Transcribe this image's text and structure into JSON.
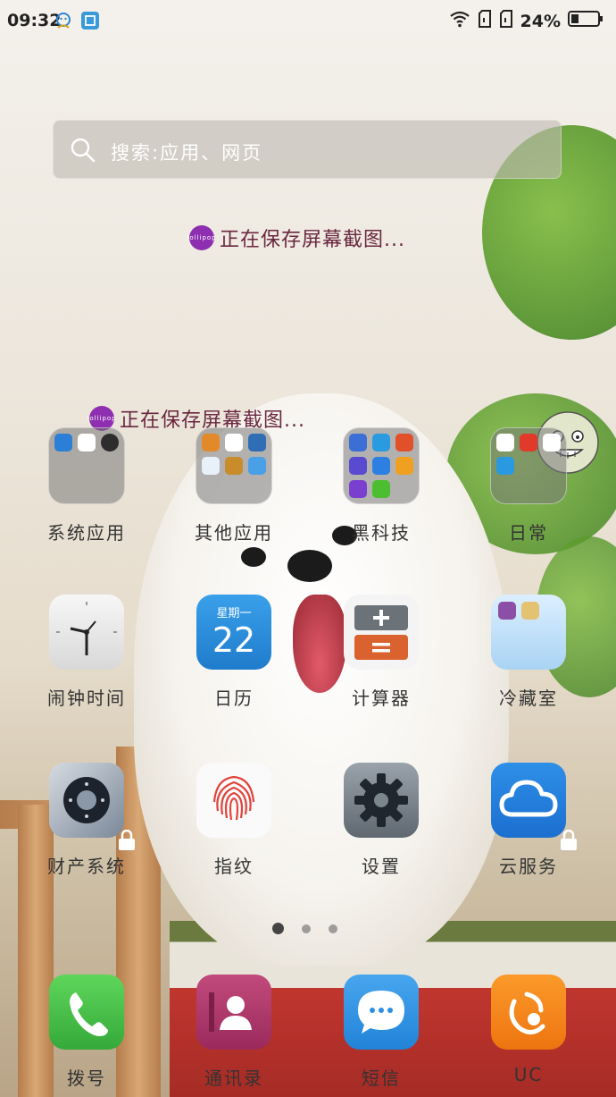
{
  "status_bar": {
    "time": "09:32",
    "battery_percent": "24%",
    "icons": [
      "notification-face-icon",
      "screenshot-icon",
      "wifi-icon",
      "sim1-icon",
      "sim2-icon",
      "battery-icon"
    ]
  },
  "search": {
    "placeholder": "搜索:应用、网页"
  },
  "toasts": {
    "first": "正在保存屏幕截图...",
    "second": "正在保存屏幕截图..."
  },
  "apps": {
    "row1": [
      {
        "label": "系统应用",
        "type": "folder"
      },
      {
        "label": "其他应用",
        "type": "folder"
      },
      {
        "label": "黑科技",
        "type": "folder"
      },
      {
        "label": "日常",
        "type": "folder"
      }
    ],
    "row2": [
      {
        "label": "闹钟时间",
        "icon": "clock-icon"
      },
      {
        "label": "日历",
        "icon": "calendar-icon",
        "weekday": "星期一",
        "day": "22"
      },
      {
        "label": "计算器",
        "icon": "calculator-icon"
      },
      {
        "label": "冷藏室",
        "icon": "freezer-folder-icon"
      }
    ],
    "row3": [
      {
        "label": "财产系统",
        "icon": "safe-icon",
        "locked": true
      },
      {
        "label": "指纹",
        "icon": "fingerprint-icon"
      },
      {
        "label": "设置",
        "icon": "gear-icon"
      },
      {
        "label": "云服务",
        "icon": "cloud-icon",
        "locked": true
      }
    ]
  },
  "page_indicator": {
    "count": 3,
    "active": 1
  },
  "dock": [
    {
      "label": "拨号",
      "icon": "phone-icon"
    },
    {
      "label": "通讯录",
      "icon": "contacts-icon"
    },
    {
      "label": "短信",
      "icon": "messages-icon"
    },
    {
      "label": "UC",
      "icon": "uc-browser-icon"
    }
  ],
  "colors": {
    "phone": "#4cc247",
    "contacts": "#b23a6a",
    "messages": "#2d8fe2",
    "uc": "#f08a1a",
    "calendar": "#2e8fdc",
    "cloud": "#1f7fe0"
  }
}
